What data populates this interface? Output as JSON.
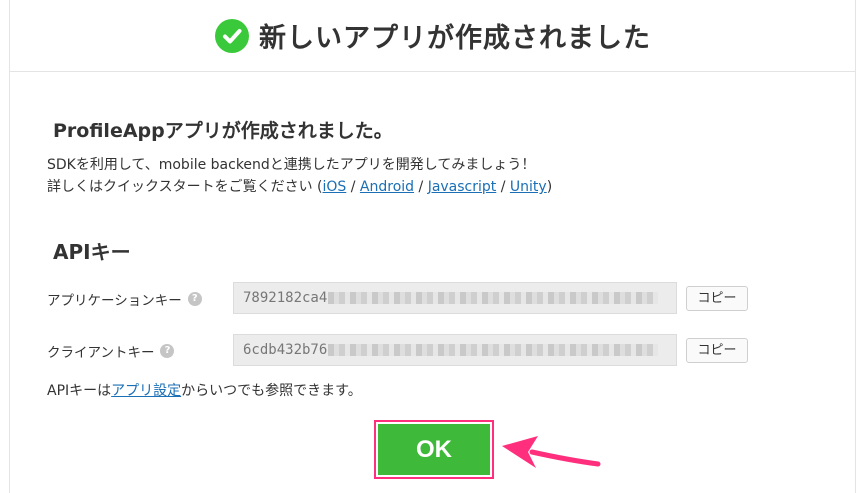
{
  "header": {
    "title": "新しいアプリが作成されました",
    "icon": "check-circle-icon",
    "icon_color": "#3ac93a"
  },
  "content": {
    "subtitle": "ProfileAppアプリが作成されました。",
    "description_line1": "SDKを利用して、mobile backendと連携したアプリを開発してみましょう！",
    "description_line2_prefix": "詳しくはクイックスタートをご覧ください (",
    "links": [
      "iOS",
      "Android",
      "Javascript",
      "Unity"
    ],
    "separator": " / ",
    "description_line2_suffix": ")",
    "link_color": "#1a6fb5"
  },
  "api_keys": {
    "section_title": "APIキー",
    "help_symbol": "?",
    "copy_label": "コピー",
    "rows": [
      {
        "label": "アプリケーションキー",
        "value": "7892182ca4"
      },
      {
        "label": "クライアントキー",
        "value": "6cdb432b76"
      }
    ]
  },
  "note": {
    "prefix": "APIキーは",
    "link": "アプリ設定",
    "suffix": "からいつでも参照できます。"
  },
  "ok_button": {
    "label": "OK",
    "color": "#3fb93a",
    "highlight_color": "#ff2f7d"
  }
}
